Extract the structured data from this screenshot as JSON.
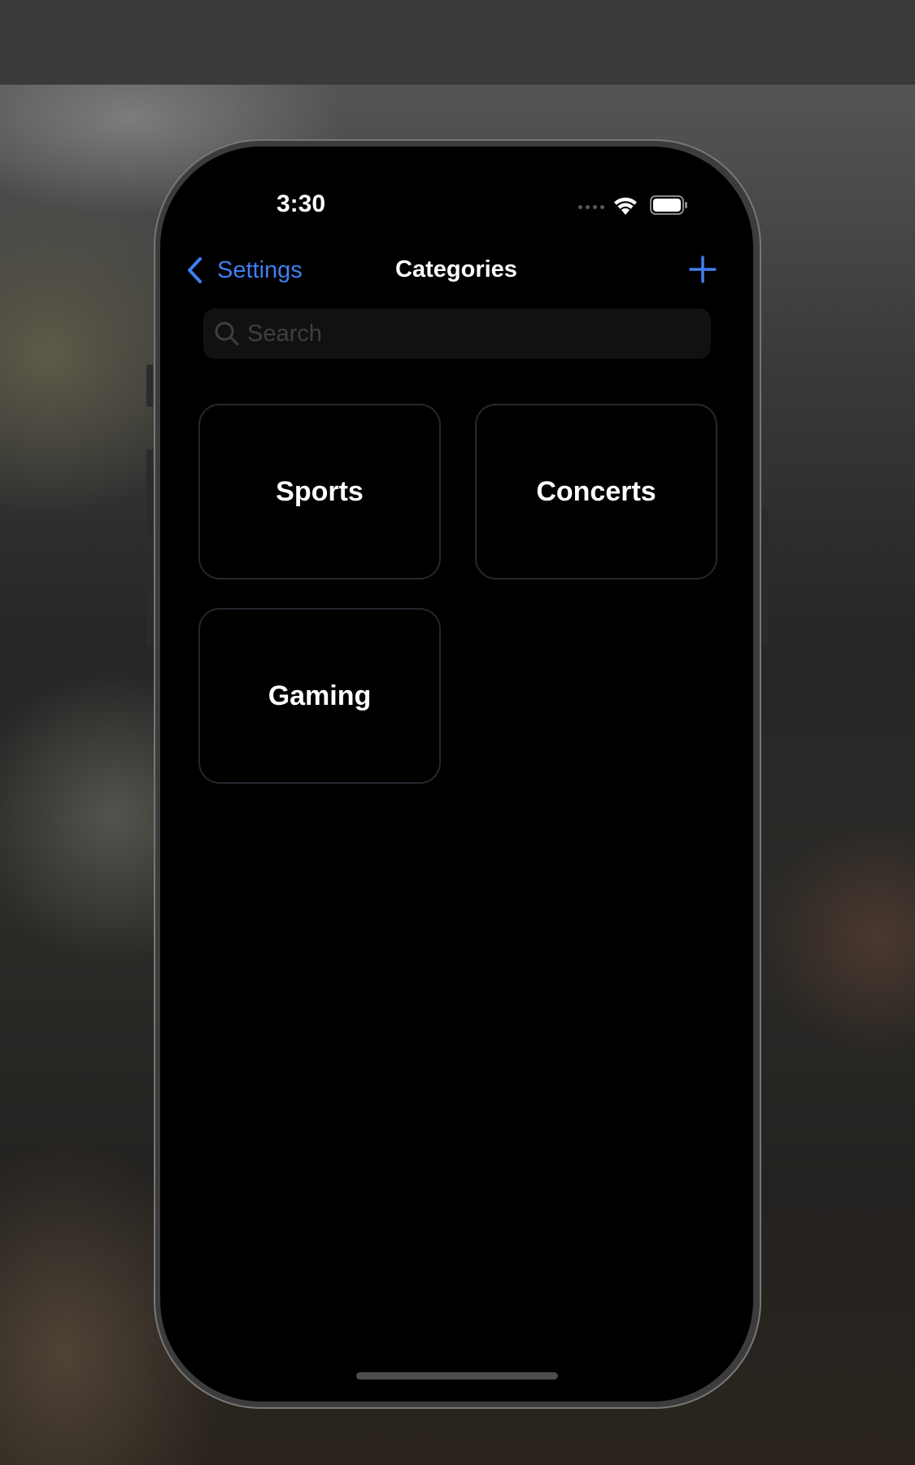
{
  "status_bar": {
    "time": "3:30",
    "icons": [
      "signal-icon",
      "wifi-icon",
      "battery-icon"
    ]
  },
  "nav": {
    "back_label": "Settings",
    "title": "Categories",
    "add_icon": "plus-icon"
  },
  "search": {
    "placeholder": "Search",
    "value": ""
  },
  "categories": [
    {
      "label": "Sports"
    },
    {
      "label": "Concerts"
    },
    {
      "label": "Gaming"
    }
  ],
  "colors": {
    "accent": "#3f7ff2",
    "background": "#000000",
    "tile_border": "#262630",
    "search_background": "#111113"
  }
}
